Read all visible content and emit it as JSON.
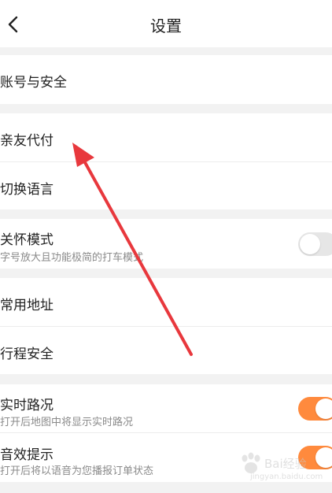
{
  "header": {
    "title": "设置",
    "back_icon": "chevron-left-icon"
  },
  "rows": {
    "account_security": {
      "label": "账号与安全"
    },
    "family_pay": {
      "label": "亲友代付"
    },
    "switch_language": {
      "label": "切换语言"
    },
    "care_mode": {
      "label": "关怀模式",
      "sub": "字号放大且功能极简的打车模式",
      "toggle_on": false
    },
    "common_address": {
      "label": "常用地址"
    },
    "trip_safety": {
      "label": "行程安全"
    },
    "realtime_traffic": {
      "label": "实时路况",
      "sub": "打开后地图中将显示实时路况",
      "toggle_on": true
    },
    "sound_prompt": {
      "label": "音效提示",
      "sub": "打开后将以语音为您播报订单状态",
      "toggle_on": true
    }
  },
  "colors": {
    "toggle_on": "#ff8a3d",
    "toggle_off": "#e6e6e6",
    "arrow": "#e8383d",
    "background": "#f2f2f2"
  },
  "watermark": {
    "text": "Bai经验",
    "url": "jingyan.baidu.com"
  }
}
